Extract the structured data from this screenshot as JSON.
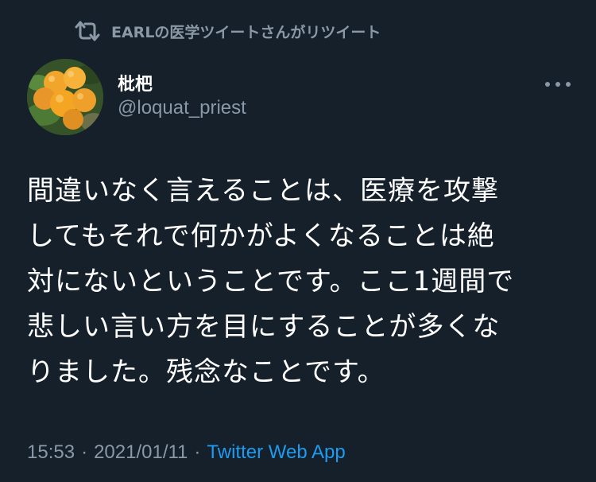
{
  "retweet_context": {
    "text": "EARLの医学ツイートさんがリツイート",
    "icon": "retweet-icon"
  },
  "author": {
    "display_name": "枇杷",
    "handle": "@loquat_priest",
    "avatar_icon": "loquat-avatar"
  },
  "more_menu": {
    "icon": "more-icon"
  },
  "tweet": {
    "text": "間違いなく言えることは、医療を攻撃\nしてもそれで何かがよくなることは絶\n対にないということです。ここ1週間で\n悲しい言い方を目にすることが多くな\nりました。残念なことです。"
  },
  "meta": {
    "time": "15:53",
    "separator": "·",
    "date": "2021/01/11",
    "source": "Twitter Web App"
  },
  "colors": {
    "background": "#15202b",
    "text_primary": "#ffffff",
    "text_secondary": "#8b98a5",
    "link": "#1d9bf0"
  }
}
